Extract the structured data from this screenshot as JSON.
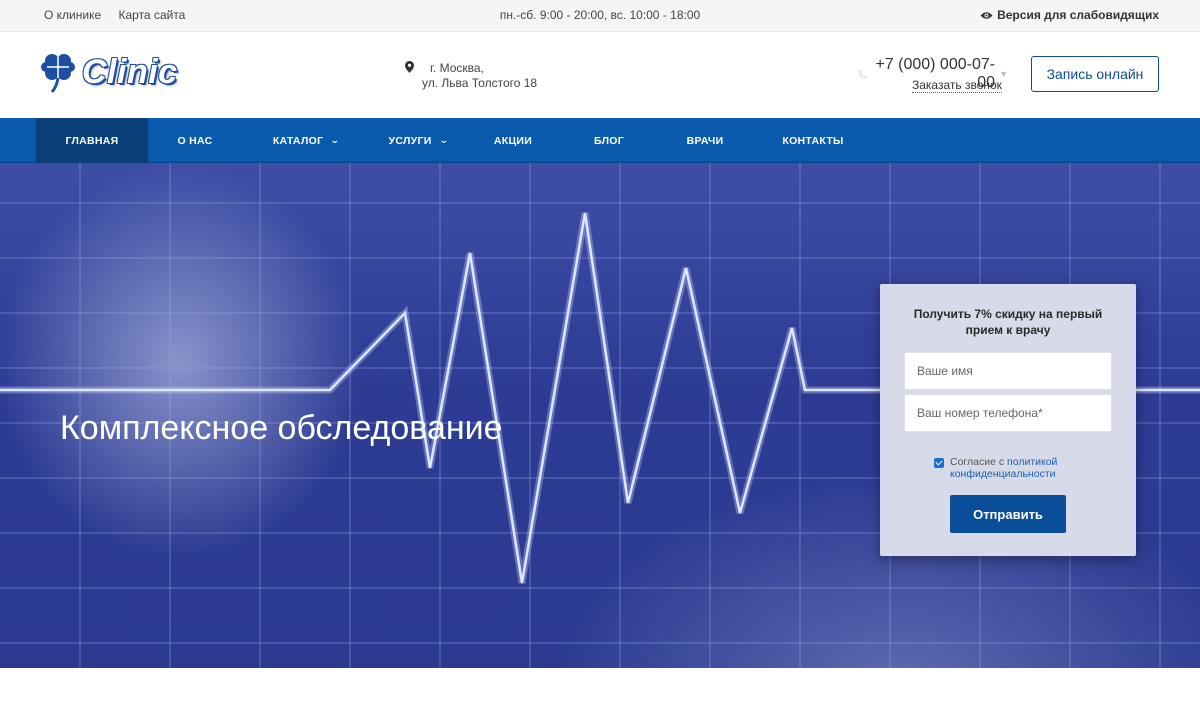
{
  "topbar": {
    "links": [
      "О клинике",
      "Карта сайта"
    ],
    "hours": "пн.-сб. 9:00 - 20:00, вс. 10:00 - 18:00",
    "vision_label": "Версия для слабовидящих"
  },
  "header": {
    "logo_text": "Clinic",
    "address_line1": "г. Москва,",
    "address_line2": "ул. Льва Толстого 18",
    "phone": "+7 (000) 000-07-00",
    "callback_label": "Заказать звонок",
    "book_button": "Запись онлайн"
  },
  "nav": {
    "items": [
      {
        "label": "ГЛАВНАЯ"
      },
      {
        "label": "О НАС"
      },
      {
        "label": "КАТАЛОГ"
      },
      {
        "label": "УСЛУГИ"
      },
      {
        "label": "АКЦИИ"
      },
      {
        "label": "БЛОГ"
      },
      {
        "label": "ВРАЧИ"
      },
      {
        "label": "КОНТАКТЫ"
      }
    ]
  },
  "hero": {
    "title": "Комплексное обследование"
  },
  "form": {
    "heading": "Получить 7% скидку на первый прием к врачу",
    "name_placeholder": "Ваше имя",
    "phone_placeholder": "Ваш номер телефона*",
    "consent_text": "Согласие с",
    "consent_link": "политикой конфиденциальности",
    "submit_label": "Отправить"
  },
  "colors": {
    "brand_blue": "#0a5aad",
    "nav_active": "#0a3f7a",
    "button_blue": "#0a4d99"
  }
}
